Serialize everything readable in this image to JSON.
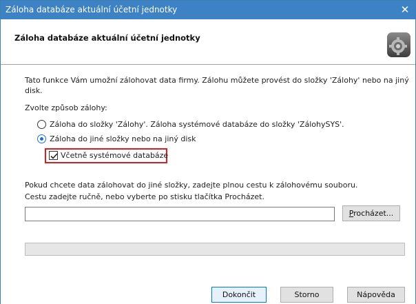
{
  "window": {
    "title": "Záloha databáze aktuální účetní jednotky",
    "close_glyph": "✕"
  },
  "header": {
    "title": "Záloha databáze aktuální účetní jednotky",
    "icon": "gear-icon"
  },
  "content": {
    "intro_line1": "Tato funkce Vám umožní zálohovat data firmy. Zálohu můžete provést do složky 'Zálohy' nebo na jiný",
    "intro_line2": "disk.",
    "choose_label": "Zvolte způsob zálohy:",
    "options": [
      {
        "label": "Záloha do složky 'Zálohy'. Záloha systémové databáze do složky 'ZálohySYS'.",
        "checked": false
      },
      {
        "label": "Záloha do jiné složky nebo na jiný disk",
        "checked": true
      }
    ],
    "include_system_db": {
      "label": "Včetně systémové databáze",
      "checked": true
    },
    "path_hint_line1": "Pokud chcete data zálohovat do jiné složky, zadejte plnou cestu k zálohovému souboru.",
    "path_hint_line2": "Cestu zadejte ručně, nebo vyberte po stisku tlačítka Procházet.",
    "path_value": "",
    "browse_button": {
      "underlined": "P",
      "rest": "rocházet..."
    },
    "progress": 0
  },
  "footer": {
    "finish_label": "Dokončit",
    "cancel_label": "Storno",
    "help_label": "Nápověda"
  },
  "colors": {
    "titlebar": "#3c82c4",
    "highlight": "#d42020",
    "accent": "#1a72c8"
  }
}
